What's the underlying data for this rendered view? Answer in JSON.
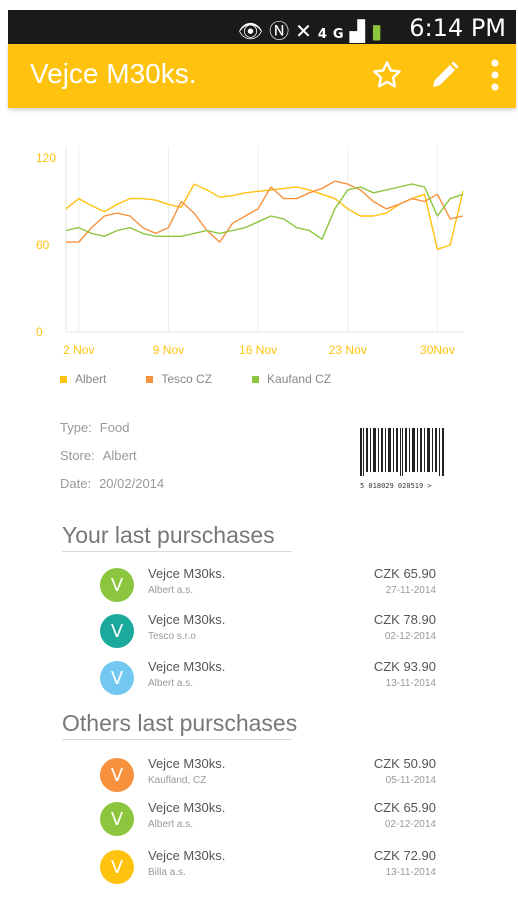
{
  "status_bar": {
    "time": "6:14 PM",
    "network": "4G"
  },
  "app_bar": {
    "title": "Vejce M30ks.",
    "actions": [
      {
        "name": "favorite-star-icon"
      },
      {
        "name": "edit-pencil-icon"
      },
      {
        "name": "more-vert-icon"
      }
    ],
    "color": "#ffc20e"
  },
  "chart_data": {
    "type": "line",
    "x": [
      "1 Nov",
      "2 Nov",
      "3 Nov",
      "4 Nov",
      "5 Nov",
      "6 Nov",
      "7 Nov",
      "8 Nov",
      "9 Nov",
      "10 Nov",
      "11 Nov",
      "12 Nov",
      "13 Nov",
      "14 Nov",
      "15 Nov",
      "16 Nov",
      "17 Nov",
      "18 Nov",
      "19 Nov",
      "20 Nov",
      "21 Nov",
      "22 Nov",
      "23 Nov",
      "24 Nov",
      "25 Nov",
      "26 Nov",
      "27 Nov",
      "28 Nov",
      "29 Nov",
      "30 Nov",
      "1 Dec",
      "2 Dec"
    ],
    "x_tick_labels": [
      "2 Nov",
      "9 Nov",
      "16 Nov",
      "23 Nov",
      "30Nov"
    ],
    "y_ticks": [
      "0",
      "60",
      "120"
    ],
    "ylim": [
      0,
      120
    ],
    "series": [
      {
        "name": "Albert",
        "color": "#ffc20e",
        "values": [
          85,
          92,
          87,
          83,
          88,
          92,
          92,
          91,
          88,
          86,
          102,
          98,
          93,
          94,
          96,
          97,
          98,
          99,
          100,
          98,
          95,
          92,
          85,
          80,
          80,
          82,
          88,
          92,
          95,
          57,
          60,
          97
        ]
      },
      {
        "name": "Tesco CZ",
        "color": "#f7913d",
        "values": [
          62,
          62,
          72,
          80,
          82,
          80,
          72,
          68,
          72,
          90,
          82,
          70,
          62,
          75,
          80,
          85,
          100,
          92,
          92,
          96,
          99,
          104,
          102,
          98,
          90,
          85,
          88,
          92,
          90,
          95,
          78,
          80
        ]
      },
      {
        "name": "Kaufand CZ",
        "color": "#8cc63f",
        "values": [
          70,
          72,
          68,
          66,
          70,
          72,
          68,
          66,
          66,
          66,
          68,
          70,
          68,
          70,
          72,
          76,
          80,
          78,
          72,
          70,
          64,
          85,
          98,
          100,
          96,
          98,
          100,
          102,
          100,
          80,
          92,
          95
        ]
      }
    ]
  },
  "details": {
    "type_label": "Type:",
    "type_value": "Food",
    "store_label": "Store:",
    "store_value": "Albert",
    "date_label": "Date:",
    "date_value": "20/02/2014",
    "barcode_text": "5 018029 020519 >"
  },
  "your_purchases": {
    "title": "Your last purschases",
    "items": [
      {
        "initial": "V",
        "name": "Vejce M30ks.",
        "store": "Albert a.s.",
        "price": "CZK 65.90",
        "date": "27-11-2014",
        "color": "#8cc63f"
      },
      {
        "initial": "V",
        "name": "Vejce M30ks.",
        "store": "Tesco s.r.o",
        "price": "CZK 78.90",
        "date": "02-12-2014",
        "color": "#1aa99a"
      },
      {
        "initial": "V",
        "name": "Vejce M30ks.",
        "store": "Albert a.s.",
        "price": "CZK 93.90",
        "date": "13-11-2014",
        "color": "#72c8f0"
      }
    ]
  },
  "others_purchases": {
    "title": "Others last purschases",
    "items": [
      {
        "initial": "V",
        "name": "Vejce M30ks.",
        "store": "Kaufland, CZ",
        "price": "CZK 50.90",
        "date": "05-11-2014",
        "color": "#f7913d"
      },
      {
        "initial": "V",
        "name": "Vejce M30ks.",
        "store": "Albert a.s.",
        "price": "CZK 65.90",
        "date": "02-12-2014",
        "color": "#8cc63f"
      },
      {
        "initial": "V",
        "name": "Vejce M30ks.",
        "store": "Billa a.s.",
        "price": "CZK 72.90",
        "date": "13-11-2014",
        "color": "#ffc20e"
      }
    ]
  }
}
